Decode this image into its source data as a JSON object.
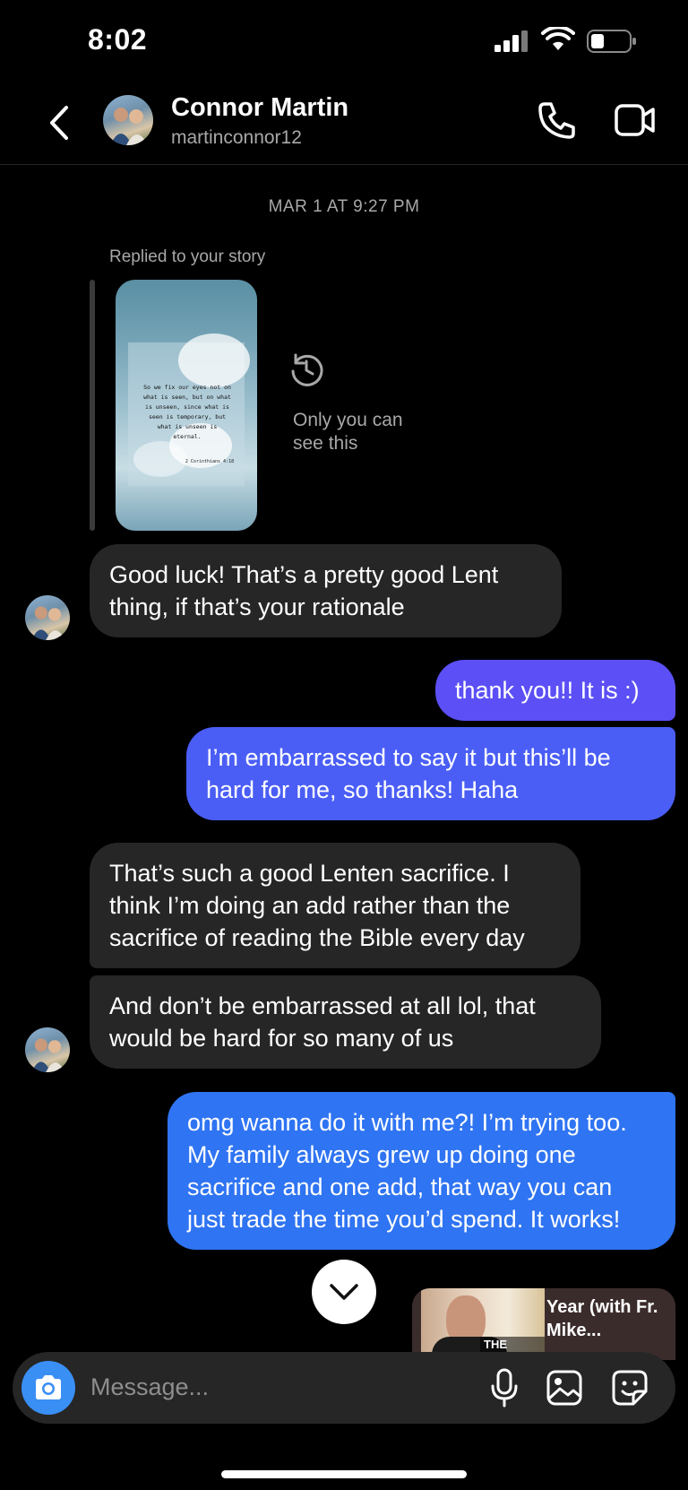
{
  "status_bar": {
    "time": "8:02"
  },
  "header": {
    "name": "Connor Martin",
    "handle": "martinconnor12"
  },
  "thread": {
    "timestamp": "MAR 1 AT 9:27 PM",
    "replied_label": "Replied to your story",
    "story_notice": "Only you can see this",
    "story_verse": "So we fix our eyes not on what is seen, but on what is unseen, since what is seen is temporary, but what is unseen is eternal.",
    "story_reference": "2 Corinthians 4:18",
    "messages": [
      {
        "from": "them",
        "text": "Good luck! That’s a pretty good Lent thing, if that’s your rationale"
      },
      {
        "from": "me",
        "text": "thank you!! It is :)"
      },
      {
        "from": "me",
        "text": "I’m embarrassed to say it but this’ll be hard for me, so thanks! Haha"
      },
      {
        "from": "them",
        "text": "That’s such a good Lenten sacrifice. I think I’m doing an add rather than the sacrifice of reading the Bible every day"
      },
      {
        "from": "them",
        "text": "And don’t be embarrassed at all lol, that would be hard for so many of us"
      },
      {
        "from": "me",
        "text": "omg wanna do it with me?! I’m trying too. My family always grew up doing one sacrifice and one add, that way you can just trade the time you’d spend. It works!"
      }
    ]
  },
  "link_preview": {
    "badge": "THE BIBLE",
    "title": "Year (with Fr. Mike..."
  },
  "composer": {
    "placeholder": "Message..."
  },
  "colors": {
    "incoming_bubble": "#262626",
    "outgoing_purple": "#5b4ff5",
    "outgoing_blue": "#2f74f2",
    "camera_button": "#3a8ff5"
  }
}
